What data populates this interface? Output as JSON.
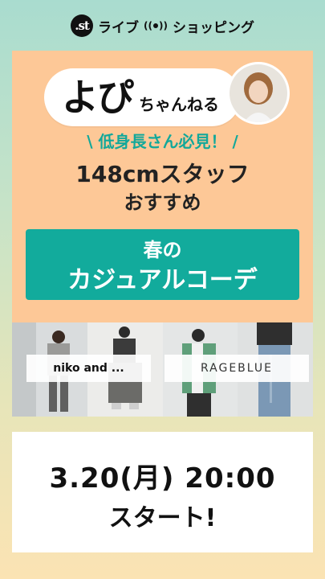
{
  "header": {
    "logo_text": ".st",
    "live_label": "ライブ",
    "live_icon": "broadcast-icon",
    "shopping_label": "ショッピング"
  },
  "card": {
    "title_main": "よぴ",
    "title_sub": "ちゃんねる",
    "tagline": "低身長さん必見！",
    "headline_line1": "148cmスタッフ",
    "headline_line2": "おすすめ",
    "banner_line1": "春の",
    "banner_line2": "カジュアルコーデ",
    "brand_left": "niko and ...",
    "brand_right": "RAGEBLUE"
  },
  "event": {
    "date": "3.20(月) 20:00",
    "start": "スタート!"
  },
  "colors": {
    "card_bg": "#fdc897",
    "accent": "#12ab9c"
  }
}
